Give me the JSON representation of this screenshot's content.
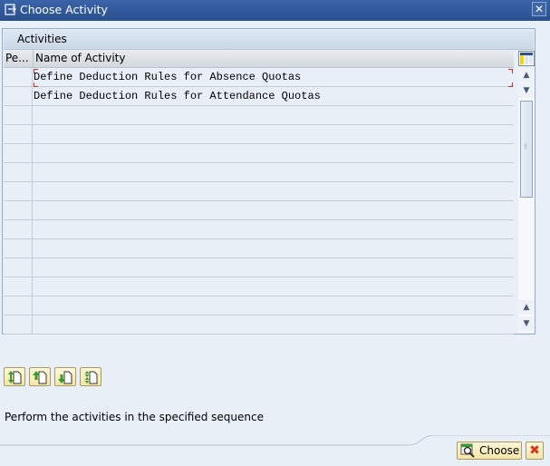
{
  "window": {
    "title": "Choose Activity",
    "close_icon": "close-icon"
  },
  "panel": {
    "title": "Activities"
  },
  "table": {
    "columns": [
      "Pe...",
      "Name of Activity"
    ],
    "rows": [
      {
        "name": "Define Deduction Rules for Absence Quotas"
      },
      {
        "name": "Define Deduction Rules for Attendance Quotas"
      },
      {
        "name": ""
      },
      {
        "name": ""
      },
      {
        "name": ""
      },
      {
        "name": ""
      },
      {
        "name": ""
      },
      {
        "name": ""
      },
      {
        "name": ""
      },
      {
        "name": ""
      },
      {
        "name": ""
      },
      {
        "name": ""
      },
      {
        "name": ""
      },
      {
        "name": ""
      }
    ]
  },
  "toolbar": {
    "buttons": [
      {
        "icon": "move-up-down-icon"
      },
      {
        "icon": "move-up-icon"
      },
      {
        "icon": "move-down-icon"
      },
      {
        "icon": "move-both-icon"
      }
    ]
  },
  "message": "Perform the activities in the specified sequence",
  "footer": {
    "choose_label": "Choose",
    "cancel_icon": "cancel-icon"
  }
}
